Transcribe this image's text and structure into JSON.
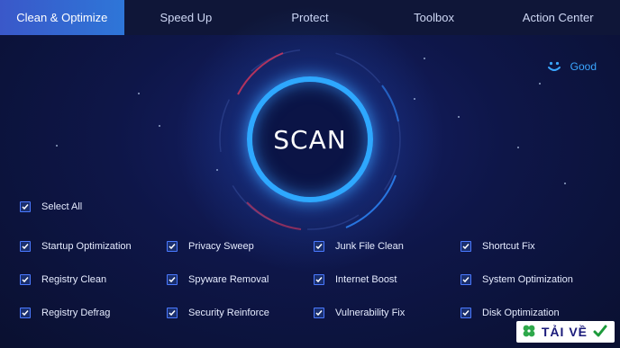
{
  "nav": {
    "tabs": [
      {
        "label": "Clean & Optimize",
        "active": true
      },
      {
        "label": "Speed Up",
        "active": false
      },
      {
        "label": "Protect",
        "active": false
      },
      {
        "label": "Toolbox",
        "active": false
      },
      {
        "label": "Action Center",
        "active": false
      }
    ]
  },
  "status": {
    "icon": "smiley-face-icon",
    "label": "Good",
    "color": "#3aa6ff"
  },
  "scan": {
    "label": "SCAN",
    "ring_color": "#2ea8ff"
  },
  "select_all": {
    "label": "Select All",
    "checked": true
  },
  "options": [
    {
      "label": "Startup Optimization",
      "checked": true
    },
    {
      "label": "Privacy Sweep",
      "checked": true
    },
    {
      "label": "Junk File Clean",
      "checked": true
    },
    {
      "label": "Shortcut Fix",
      "checked": true
    },
    {
      "label": "Registry Clean",
      "checked": true
    },
    {
      "label": "Spyware Removal",
      "checked": true
    },
    {
      "label": "Internet Boost",
      "checked": true
    },
    {
      "label": "System Optimization",
      "checked": true
    },
    {
      "label": "Registry Defrag",
      "checked": true
    },
    {
      "label": "Security Reinforce",
      "checked": true
    },
    {
      "label": "Vulnerability Fix",
      "checked": true
    },
    {
      "label": "Disk Optimization",
      "checked": true
    }
  ],
  "watermark": {
    "text": "TẢI VỀ",
    "icons": [
      "clover-icon",
      "checkmark-icon"
    ]
  },
  "colors": {
    "background": "#0b1234",
    "accent": "#2e76d8",
    "checkbox_border": "#4a79ff"
  }
}
